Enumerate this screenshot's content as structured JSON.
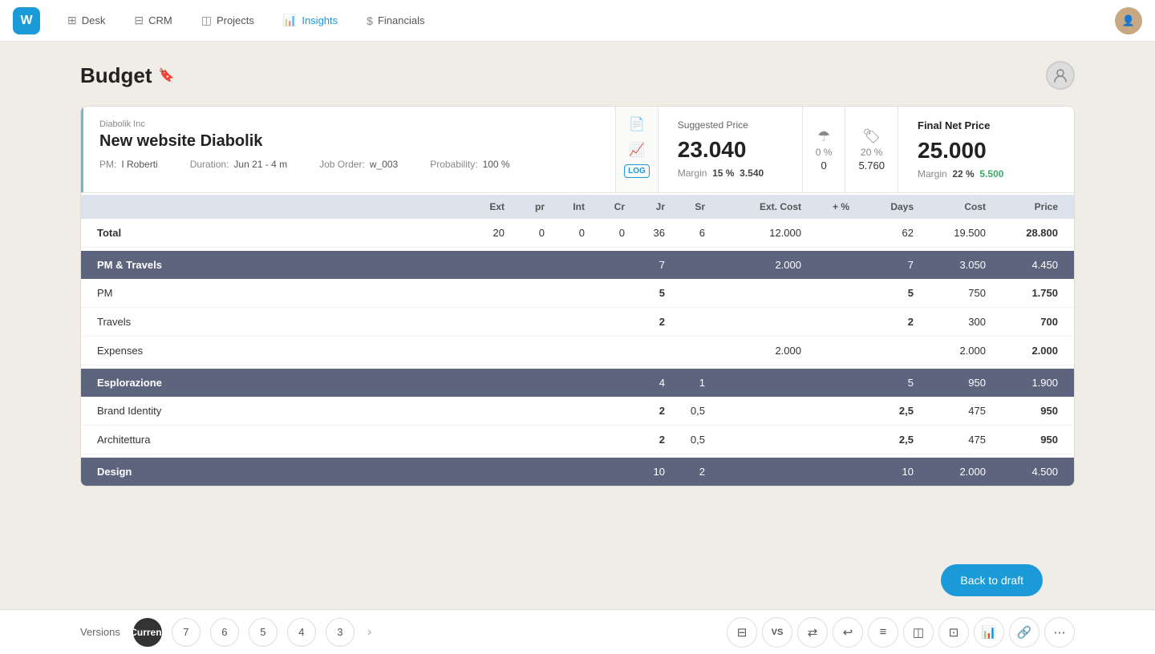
{
  "app": {
    "logo": "W",
    "nav": [
      {
        "id": "desk",
        "label": "Desk",
        "icon": "⊞"
      },
      {
        "id": "crm",
        "label": "CRM",
        "icon": "⊟"
      },
      {
        "id": "projects",
        "label": "Projects",
        "icon": "◫"
      },
      {
        "id": "insights",
        "label": "Insights",
        "icon": "📊",
        "active": true
      },
      {
        "id": "financials",
        "label": "Financials",
        "icon": "$"
      }
    ]
  },
  "page": {
    "title": "Budget",
    "header_icon": "🔖"
  },
  "project": {
    "company": "Diabolik Inc",
    "name": "New website Diabolik",
    "pm_label": "PM:",
    "pm_value": "I Roberti",
    "duration_label": "Duration:",
    "duration_value": "Jun 21 - 4 m",
    "probability_label": "Probability:",
    "probability_value": "100 %",
    "job_order_label": "Job Order:",
    "job_order_value": "w_003"
  },
  "suggested_price": {
    "label": "Suggested Price",
    "value": "23.040",
    "margin_label": "Margin",
    "margin_pct": "15 %",
    "margin_value": "3.540"
  },
  "icon_panel1": {
    "pct": "0 %",
    "num": "0"
  },
  "icon_panel2": {
    "pct": "20 %",
    "num": "5.760"
  },
  "final_net_price": {
    "label": "Final Net Price",
    "value": "25.000",
    "margin_label": "Margin",
    "margin_pct": "22 %",
    "margin_value": "5.500"
  },
  "table": {
    "columns": [
      "",
      "Ext",
      "pr",
      "Int",
      "Cr",
      "Jr",
      "Sr",
      "Ext. Cost",
      "+ %",
      "Days",
      "Cost",
      "Price"
    ],
    "total_row": {
      "label": "Total",
      "ext": "20",
      "pr": "0",
      "int": "0",
      "cr": "0",
      "jr": "36",
      "sr": "6",
      "ext_cost": "12.000",
      "plus_pct": "",
      "days": "62",
      "cost": "19.500",
      "price": "28.800"
    },
    "sections": [
      {
        "label": "PM & Travels",
        "ext": "",
        "pr": "",
        "int": "",
        "cr": "",
        "jr": "7",
        "sr": "",
        "ext_cost": "2.000",
        "plus_pct": "",
        "days": "7",
        "cost": "3.050",
        "price": "4.450",
        "rows": [
          {
            "label": "PM",
            "ext": "",
            "pr": "",
            "int": "",
            "cr": "",
            "jr": "5",
            "sr": "",
            "ext_cost": "",
            "plus_pct": "",
            "days": "5",
            "cost": "750",
            "price": "1.750"
          },
          {
            "label": "Travels",
            "ext": "",
            "pr": "",
            "int": "",
            "cr": "",
            "jr": "2",
            "sr": "",
            "ext_cost": "",
            "plus_pct": "",
            "days": "2",
            "cost": "300",
            "price": "700"
          },
          {
            "label": "Expenses",
            "ext": "",
            "pr": "",
            "int": "",
            "cr": "",
            "jr": "",
            "sr": "",
            "ext_cost": "2.000",
            "plus_pct": "",
            "days": "",
            "cost": "2.000",
            "price": "2.000"
          }
        ]
      },
      {
        "label": "Esplorazione",
        "ext": "",
        "pr": "",
        "int": "",
        "cr": "",
        "jr": "4",
        "sr": "1",
        "ext_cost": "",
        "plus_pct": "",
        "days": "5",
        "cost": "950",
        "price": "1.900",
        "rows": [
          {
            "label": "Brand Identity",
            "ext": "",
            "pr": "",
            "int": "",
            "cr": "",
            "jr": "2",
            "sr": "0,5",
            "ext_cost": "",
            "plus_pct": "",
            "days": "2,5",
            "cost": "475",
            "price": "950"
          },
          {
            "label": "Architettura",
            "ext": "",
            "pr": "",
            "int": "",
            "cr": "",
            "jr": "2",
            "sr": "0,5",
            "ext_cost": "",
            "plus_pct": "",
            "days": "2,5",
            "cost": "475",
            "price": "950"
          }
        ]
      },
      {
        "label": "Design",
        "ext": "",
        "pr": "",
        "int": "",
        "cr": "",
        "jr": "10",
        "sr": "2",
        "ext_cost": "",
        "plus_pct": "",
        "days": "10",
        "cost": "2.000",
        "price": "4.500",
        "rows": []
      }
    ]
  },
  "versions": {
    "label": "Versions",
    "current_label": "Current",
    "items": [
      "7",
      "6",
      "5",
      "4",
      "3"
    ]
  },
  "toolbar": {
    "tools": [
      "⊟",
      "¥$",
      "↻↺",
      "↩",
      "≡",
      "◫",
      "⊡",
      "▦",
      "🔗",
      "⋯"
    ]
  },
  "back_draft_button": "Back to draft"
}
